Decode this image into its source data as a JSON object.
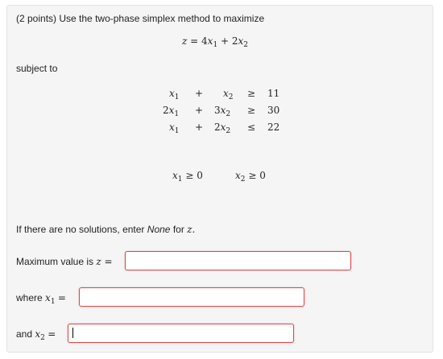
{
  "problem": {
    "points": "(2 points)",
    "prompt": "Use the two-phase simplex method to maximize",
    "objective_lhs": "z",
    "objective_rhs_text": "= 4x1 + 2x2",
    "subject_to": "subject to",
    "constraints": [
      {
        "a1": "",
        "op": "+",
        "a2": "",
        "rel": "≥",
        "rhs": "11"
      },
      {
        "a1": "2",
        "op": "+",
        "a2": "3",
        "rel": "≥",
        "rhs": "30"
      },
      {
        "a1": "",
        "op": "+",
        "a2": "2",
        "rel": "≤",
        "rhs": "22"
      }
    ],
    "nonneg_1": "≥ 0",
    "nonneg_2": "≥ 0",
    "no_solution_note_prefix": "If there are no solutions, enter",
    "no_solution_note_none": "None",
    "no_solution_note_suffix": "for",
    "no_solution_note_var": "z."
  },
  "answers": {
    "max_label": "Maximum value is",
    "max_var": "z =",
    "max_value": "",
    "x1_label": "where",
    "x1_var": "=",
    "x1_value": "",
    "x2_label": "and",
    "x2_var": "=",
    "x2_value": ""
  },
  "colors": {
    "panel_bg": "#f5f5f5",
    "input_border_error": "#d84a4a"
  }
}
